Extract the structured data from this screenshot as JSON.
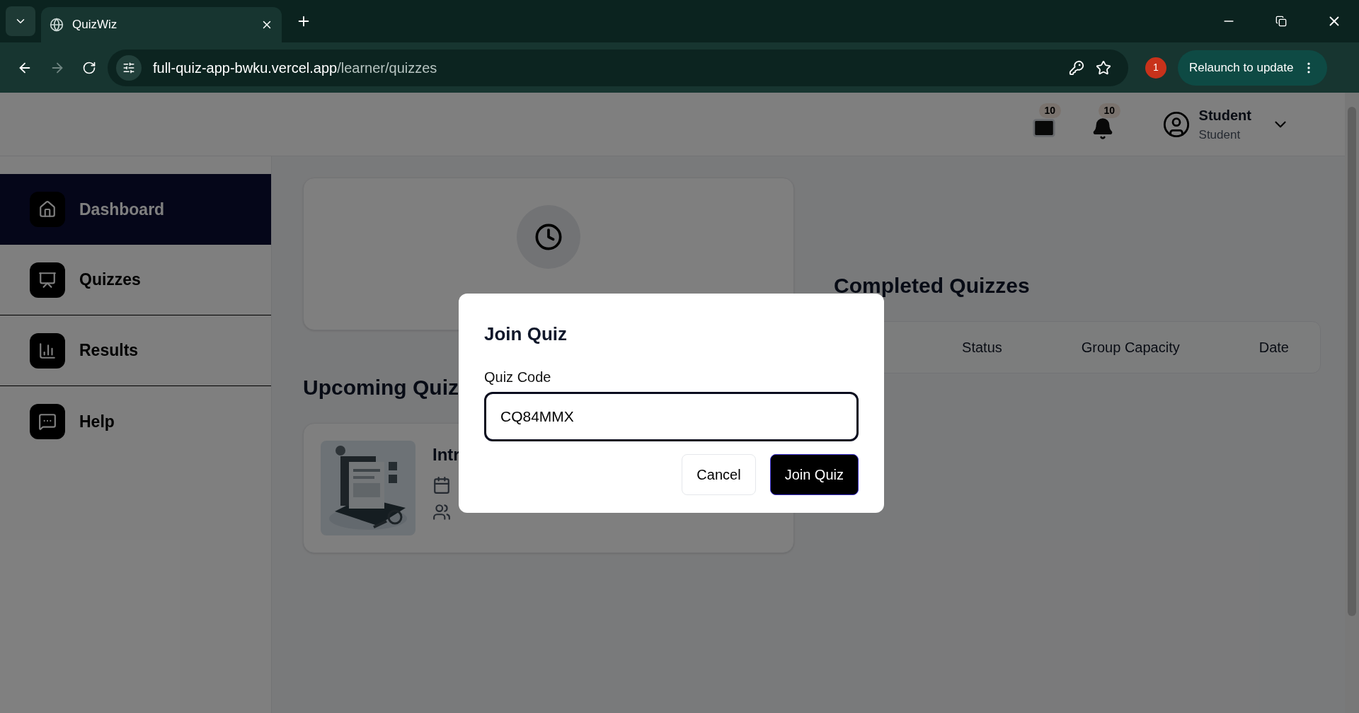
{
  "browser": {
    "tab_title": "QuizWiz",
    "url_host": "full-quiz-app-bwku.vercel.app",
    "url_path": "/learner/quizzes",
    "extension_badge": "1",
    "relaunch": "Relaunch to update"
  },
  "header": {
    "mail_count": "10",
    "bell_count": "10",
    "user_name": "Student",
    "user_role": "Student"
  },
  "sidebar": {
    "items": [
      {
        "label": "Dashboard",
        "selected": true
      },
      {
        "label": "Quizzes",
        "selected": false
      },
      {
        "label": "Results",
        "selected": false
      },
      {
        "label": "Help",
        "selected": false
      }
    ]
  },
  "upcoming": {
    "heading": "Upcoming Quiz",
    "quizzes": [
      {
        "title": "Intr",
        "kind": "picture"
      }
    ]
  },
  "completed": {
    "heading": "Completed Quizzes",
    "columns": [
      "Status",
      "Group Capacity",
      "Date"
    ]
  },
  "dialog": {
    "title": "Join Quiz",
    "field_label": "Quiz Code",
    "field_value": "CQ84MMX",
    "buttons": [
      {
        "label": "Cancel",
        "kind": "secondary"
      },
      {
        "label": "Join Quiz",
        "kind": "primary"
      }
    ]
  }
}
